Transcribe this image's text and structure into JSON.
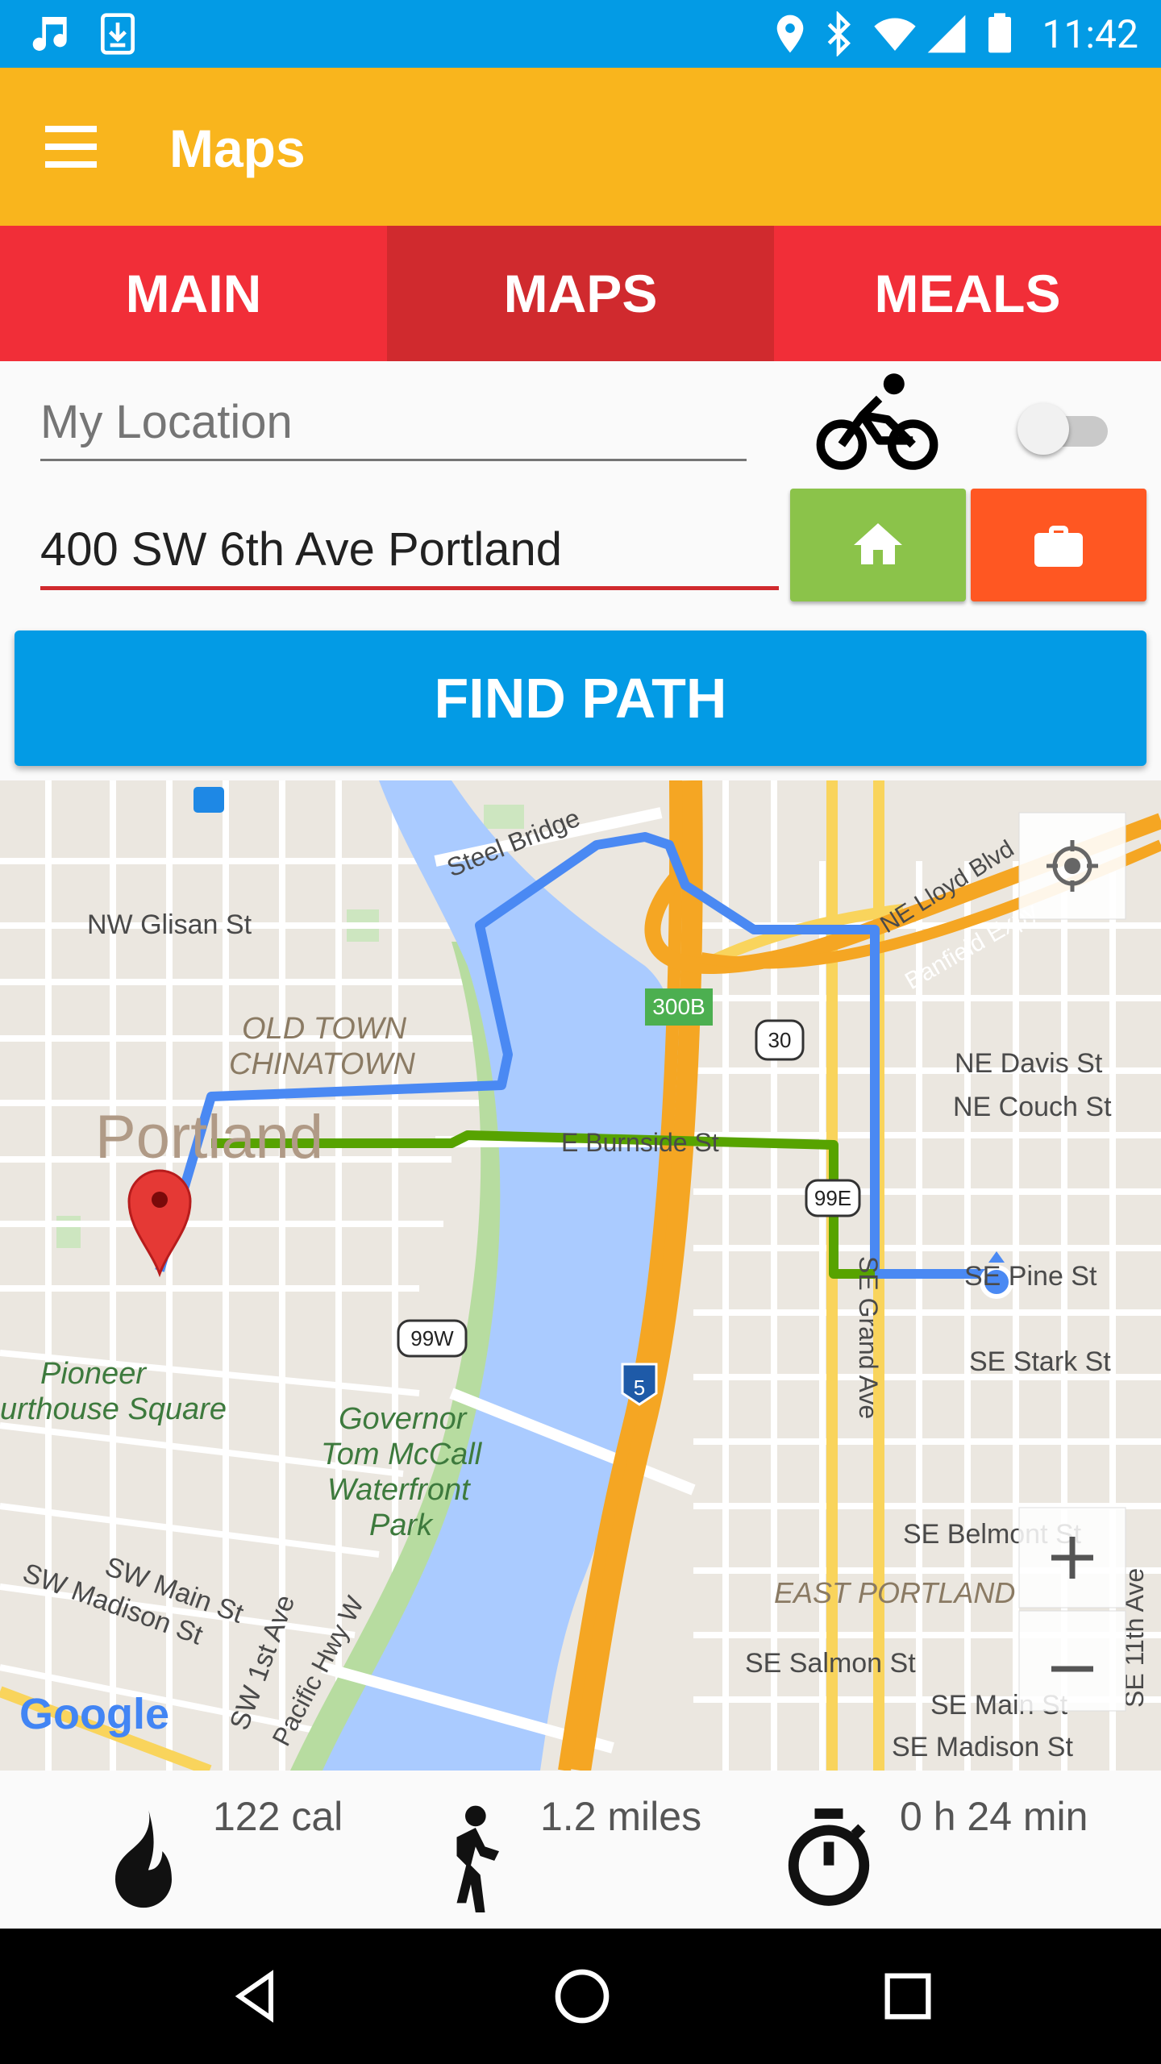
{
  "status_bar": {
    "time": "11:42"
  },
  "toolbar": {
    "title": "Maps"
  },
  "tabs": [
    {
      "label": "MAIN",
      "active": false
    },
    {
      "label": "MAPS",
      "active": true
    },
    {
      "label": "MEALS",
      "active": false
    }
  ],
  "form": {
    "origin_placeholder": "My Location",
    "destination_value": "400 SW 6th Ave Portland",
    "bike_toggle": "off",
    "find_path_label": "FIND PATH"
  },
  "colors": {
    "status_bar": "#039BE5",
    "toolbar": "#F9B51D",
    "tabs": "#F12E38",
    "active_tab": "#D02A2E",
    "home_button": "#8BC34A",
    "work_button": "#FF5722",
    "find_path": "#039BE5",
    "route_blue": "#4A89F3",
    "route_green": "#57A300"
  },
  "map": {
    "labels": {
      "glisan": "NW Glisan St",
      "steel_bridge": "Steel Bridge",
      "lloyd": "NE Lloyd Blvd",
      "banfield": "Banfield Expy",
      "old_town": "OLD TOWN",
      "chinatown": "CHINATOWN",
      "portland": "Portland",
      "burnside": "E Burnside St",
      "davis": "NE Davis St",
      "couch": "NE Couch St",
      "pine": "SE Pine St",
      "stark": "SE Stark St",
      "grand": "SE Grand Ave",
      "pioneer1": "Pioneer",
      "pioneer2": "urthouse Square",
      "governor": "Governor",
      "tom": "Tom McCall",
      "waterfront": "Waterfront",
      "park": "Park",
      "belmont": "SE Belmont St",
      "east_portland": "EAST PORTLAND",
      "salmon": "SE Salmon St",
      "main_se": "SE Main St",
      "madison_se": "SE Madison St",
      "sw_main": "SW Main St",
      "sw_madison": "SW Madison St",
      "sw_1st": "SW 1st Ave",
      "pacific": "Pacific Hwy W",
      "se_11th": "SE 11th Ave",
      "shield_300b": "300B",
      "shield_30": "30",
      "shield_99e": "99E",
      "shield_99w": "99W",
      "shield_5": "5",
      "google": "Google"
    }
  },
  "stats": {
    "calories": "122 cal",
    "distance": "1.2 miles",
    "duration": "0 h 24 min"
  }
}
